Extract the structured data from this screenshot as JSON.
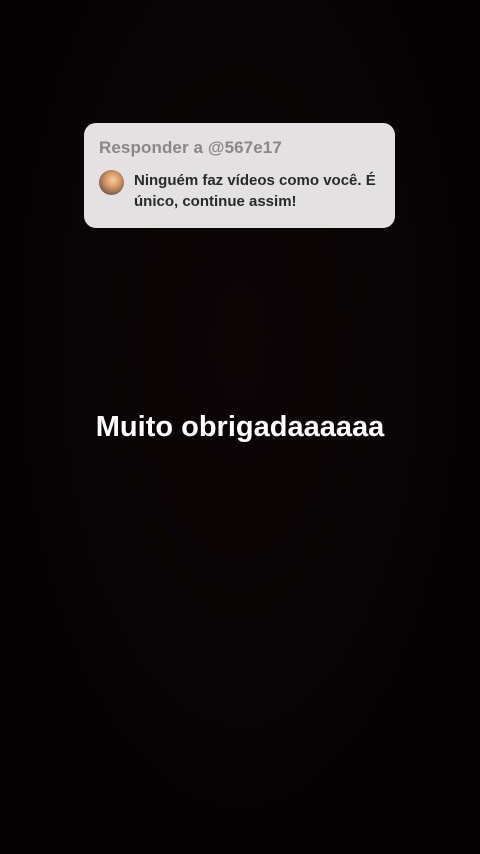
{
  "reply_card": {
    "header": "Responder a @567e17",
    "comment": "Ninguém faz vídeos como você. É único, continue  assim!",
    "avatar_icon": "user-avatar-icon"
  },
  "caption": "Muito obrigadaaaaaa",
  "colors": {
    "background": "#070203",
    "card": "#e4e1e2",
    "header_text": "#8a8788",
    "comment_text": "#2a2a2a",
    "caption_text": "#ffffff"
  }
}
